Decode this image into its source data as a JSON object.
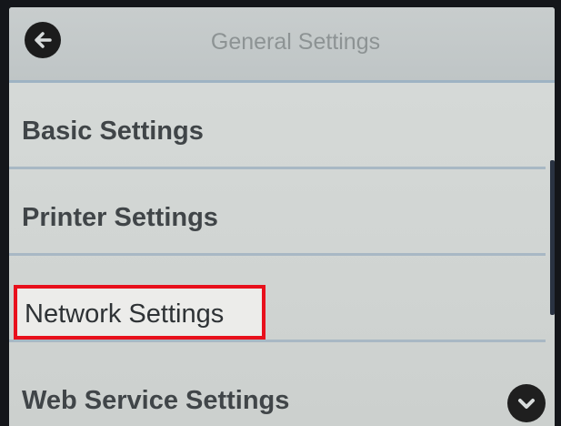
{
  "header": {
    "title": "General Settings",
    "back_icon": "arrow-left-icon"
  },
  "menu": {
    "items": [
      {
        "label": "Basic Settings",
        "highlighted": false
      },
      {
        "label": "Printer Settings",
        "highlighted": false
      },
      {
        "label": "Network Settings",
        "highlighted": true,
        "highlight_color": "#e8101c"
      },
      {
        "label": "Web Service Settings",
        "highlighted": false
      }
    ]
  },
  "scroll": {
    "down_icon": "chevron-down-icon"
  }
}
